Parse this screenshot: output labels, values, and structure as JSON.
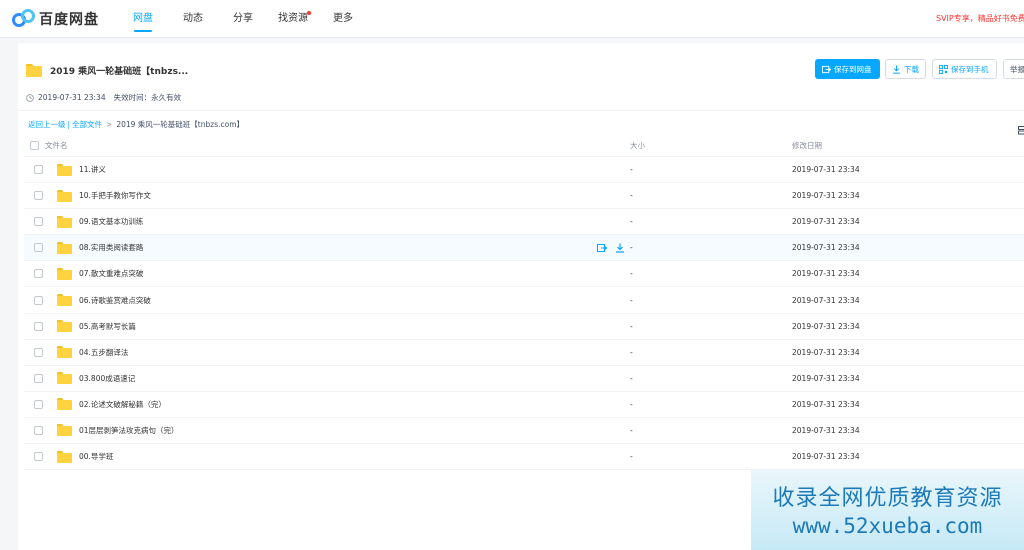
{
  "app": {
    "logo_text": "百度网盘",
    "accent": "#06a7ff",
    "folder_color": "#ffd23f"
  },
  "nav": {
    "items": [
      {
        "label": "网盘",
        "active": true
      },
      {
        "label": "动态",
        "active": false
      },
      {
        "label": "分享",
        "active": false
      },
      {
        "label": "找资源",
        "active": false,
        "dot": true
      },
      {
        "label": "更多",
        "active": false
      }
    ],
    "promo": "SVIP专享，精品好书免费看"
  },
  "share": {
    "title": "2019 乘风一轮基础班【tnbzs...",
    "date": "2019-07-31 23:34",
    "expiry": "失效时间：永久有效",
    "buttons": {
      "save": "保存到网盘",
      "download": "下载",
      "save_phone": "保存到手机",
      "report": "举报"
    }
  },
  "breadcrumb": {
    "back": "返回上一级",
    "all": "全部文件",
    "current": "2019 乘风一轮基础班【tnbzs.com】"
  },
  "table": {
    "headers": {
      "name": "文件名",
      "size": "大小",
      "date": "修改日期"
    },
    "rows": [
      {
        "name": "11.讲义",
        "size": "-",
        "date": "2019-07-31 23:34"
      },
      {
        "name": "10.手把手教你写作文",
        "size": "-",
        "date": "2019-07-31 23:34"
      },
      {
        "name": "09.语文基本功训练",
        "size": "-",
        "date": "2019-07-31 23:34"
      },
      {
        "name": "08.实用类阅读套路",
        "size": "-",
        "date": "2019-07-31 23:34",
        "hover": true
      },
      {
        "name": "07.散文重难点突破",
        "size": "-",
        "date": "2019-07-31 23:34"
      },
      {
        "name": "06.诗歌鉴赏难点突破",
        "size": "-",
        "date": "2019-07-31 23:34"
      },
      {
        "name": "05.高考默写长篇",
        "size": "-",
        "date": "2019-07-31 23:34"
      },
      {
        "name": "04.五步翻译法",
        "size": "-",
        "date": "2019-07-31 23:34"
      },
      {
        "name": "03.800成语速记",
        "size": "-",
        "date": "2019-07-31 23:34"
      },
      {
        "name": "02.论述文破解秘籍（完）",
        "size": "-",
        "date": "2019-07-31 23:34"
      },
      {
        "name": "01层层剥笋法攻克病句（完）",
        "size": "-",
        "date": "2019-07-31 23:34"
      },
      {
        "name": "00.导学班",
        "size": "-",
        "date": "2019-07-31 23:34"
      }
    ]
  },
  "watermark": {
    "line1": "收录全网优质教育资源",
    "line2": "www.52xueba.com"
  }
}
